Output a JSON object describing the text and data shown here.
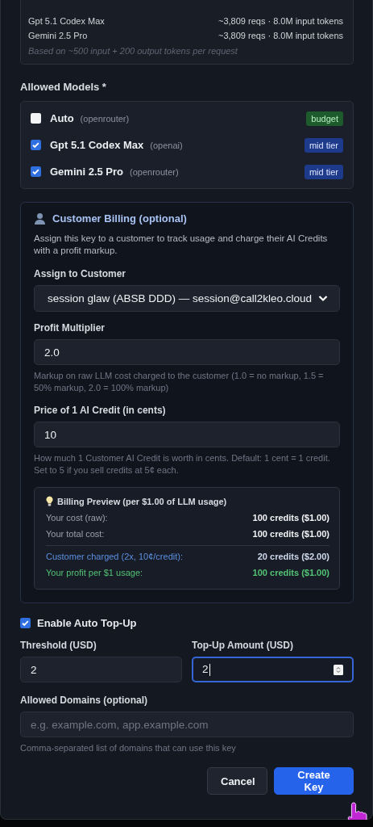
{
  "capacity": {
    "rows": [
      {
        "model": "Gpt 5.1 Codex Max",
        "estimate": "~3,809 reqs · 8.0M input tokens"
      },
      {
        "model": "Gemini 2.5 Pro",
        "estimate": "~3,809 reqs · 8.0M input tokens"
      }
    ],
    "note": "Based on ~500 input + 200 output tokens per request"
  },
  "allowed_models": {
    "label": "Allowed Models *",
    "items": [
      {
        "name": "Auto",
        "provider": "(openrouter)",
        "checked": false,
        "tier": "budget",
        "color": "#1d5a2c"
      },
      {
        "name": "Gpt 5.1 Codex Max",
        "provider": "(openai)",
        "checked": true,
        "tier": "mid tier",
        "color": "#1e3a8a"
      },
      {
        "name": "Gemini 2.5 Pro",
        "provider": "(openrouter)",
        "checked": true,
        "tier": "mid tier",
        "color": "#1e3a8a"
      }
    ]
  },
  "customer_billing": {
    "title": "Customer Billing (optional)",
    "description": "Assign this key to a customer to track usage and charge their AI Credits with a profit markup.",
    "customer": {
      "label": "Assign to Customer",
      "value": "session glaw (ABSB DDD) — session@call2kleo.cloud"
    },
    "multiplier": {
      "label": "Profit Multiplier",
      "value": "2.0",
      "hint": "Markup on raw LLM cost charged to the customer (1.0 = no markup, 1.5 = 50% markup, 2.0 = 100% markup)"
    },
    "credit_price": {
      "label": "Price of 1 AI Credit (in cents)",
      "value": "10",
      "hint": "How much 1 Customer AI Credit is worth in cents. Default: 1 cent = 1 credit. Set to 5 if you sell credits at 5¢ each."
    },
    "preview": {
      "title": "Billing Preview (per $1.00 of LLM usage)",
      "rows": [
        {
          "label": "Your cost (raw):",
          "value": "100 credits ($1.00)",
          "kind": "plain"
        },
        {
          "label": "Your total cost:",
          "value": "100 credits ($1.00)",
          "kind": "plain"
        },
        {
          "label": "Customer charged (2x, 10¢/credit):",
          "value": "20 credits ($2.00)",
          "kind": "customer"
        },
        {
          "label": "Your profit per $1 usage:",
          "value": "100 credits ($1.00)",
          "kind": "profit"
        }
      ]
    }
  },
  "auto_topup": {
    "label": "Enable Auto Top-Up",
    "checked": true
  },
  "threshold": {
    "label": "Threshold (USD)",
    "value": "2",
    "focused": false
  },
  "topup_amount": {
    "label": "Top-Up Amount (USD)",
    "value": "2",
    "focused": true
  },
  "allowed_domains": {
    "label": "Allowed Domains (optional)",
    "placeholder": "e.g. example.com, app.example.com",
    "hint": "Comma-separated list of domains that can use this key"
  },
  "buttons": [
    {
      "label": "Cancel",
      "kind": "secondary"
    },
    {
      "label": "Create Key",
      "kind": "primary"
    }
  ]
}
